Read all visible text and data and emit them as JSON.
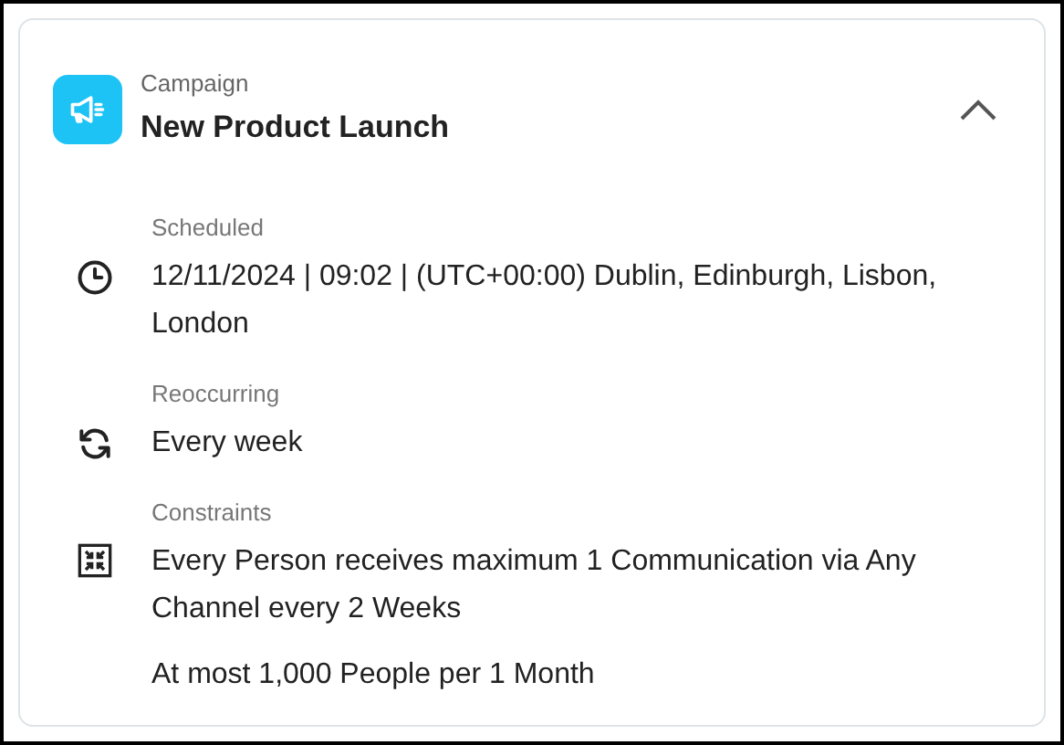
{
  "card": {
    "category": "Campaign",
    "title": "New Product Launch",
    "expanded": true,
    "sections": [
      {
        "kind": "scheduled",
        "label": "Scheduled",
        "lines": [
          "12/11/2024 | 09:02 | (UTC+00:00) Dublin, Edinburgh, Lisbon, London"
        ]
      },
      {
        "kind": "recurring",
        "label": "Reoccurring",
        "lines": [
          "Every week"
        ]
      },
      {
        "kind": "constraints",
        "label": "Constraints",
        "lines": [
          "Every Person receives maximum 1 Communication via Any Channel every 2 Weeks",
          "At most 1,000 People per 1 Month"
        ]
      }
    ]
  }
}
